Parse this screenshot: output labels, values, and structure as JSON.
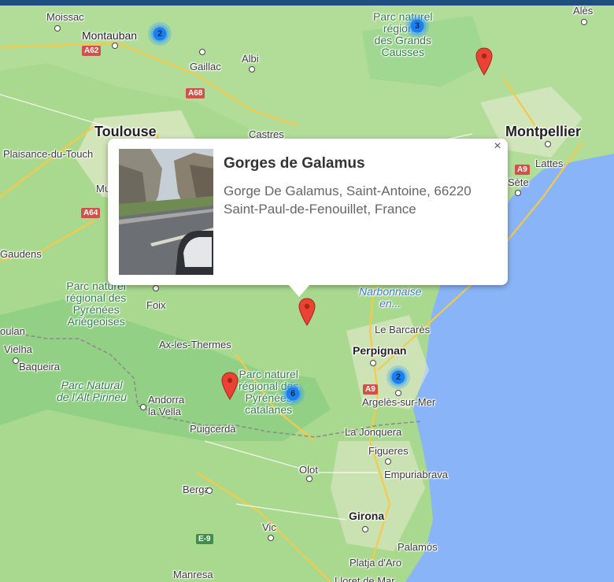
{
  "map": {
    "labels": {
      "moissac": "Moissac",
      "montauban": "Montauban",
      "gaillac": "Gaillac",
      "albi": "Albi",
      "toulouse": "Toulouse",
      "castres": "Castres",
      "plaisance": "Plaisance-du-Touch",
      "mu": "Mu",
      "gaudens": "Gaudens",
      "foix": "Foix",
      "ax": "Ax-les-Thermes",
      "oulan": "oulan",
      "vielha": "Vielha",
      "baqueira": "Baqueira",
      "andorra": "Andorra\nla Vella",
      "puigcerda": "Puigcerdà",
      "montpellier": "Montpellier",
      "ales": "Alès",
      "lattes": "Lattes",
      "sete": "Sète",
      "lebarcares": "Le Barcarès",
      "perpignan": "Perpignan",
      "argeles": "Argelès-sur-Mer",
      "lajonquera": "La Jonquera",
      "figueres": "Figueres",
      "empuriabrava": "Empuriabrava",
      "olot": "Olot",
      "berga": "Berga",
      "vic": "Vic",
      "girona": "Girona",
      "palamos": "Palamós",
      "platja": "Platja d'Aro",
      "manresa": "Manresa",
      "lloret": "Lloret de Mar",
      "park_grands_causses": "Parc naturel\nrégional\ndes Grands\nCausses",
      "park_ariegeoises": "Parc naturel\nrégional des\nPyrénées\nAriégeoises",
      "park_alt_pirineu": "Parc Natural\nde l'Alt Pirineu",
      "park_catalanes": "Parc naturel\nrégional des\nPyrénées\ncatalanes",
      "narbonnaise": "Narbonnaise\nen..."
    },
    "roads": {
      "a62": "A62",
      "a68": "A68",
      "a64": "A64",
      "a9_north": "A9",
      "a9_south": "A9",
      "e9": "E-9"
    },
    "clusters": [
      {
        "count": "2",
        "name": "montauban"
      },
      {
        "count": "3",
        "name": "grands-causses"
      },
      {
        "count": "6",
        "name": "pyrenees-catalanes"
      },
      {
        "count": "2",
        "name": "perpignan"
      }
    ],
    "markers": [
      {
        "name": "east-of-causses"
      },
      {
        "name": "gorges-de-galamus"
      },
      {
        "name": "puigcerda"
      }
    ],
    "colors": {
      "land": "#a9d98f",
      "sea": "#8ab4f8",
      "marker": "#ea4335",
      "cluster": "#1a7ff0",
      "topbar": "#1e4f7c"
    }
  },
  "popup": {
    "title": "Gorges de Galamus",
    "address": "Gorge De Galamus, Saint-Antoine, 66220 Saint-Paul-de-Fenouillet, France",
    "close_label": "×"
  }
}
